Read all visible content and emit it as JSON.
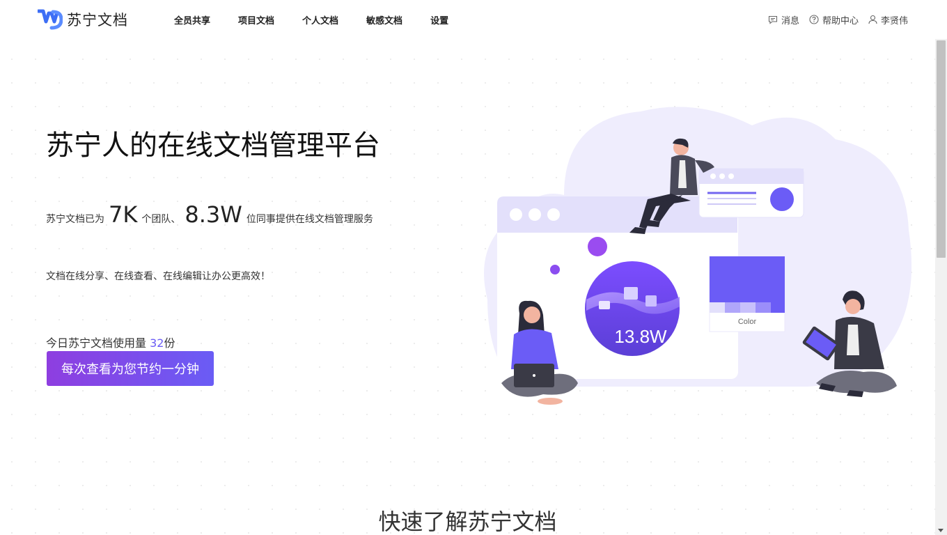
{
  "header": {
    "logo_text": "苏宁文档",
    "nav": [
      {
        "label": "全员共享"
      },
      {
        "label": "项目文档"
      },
      {
        "label": "个人文档"
      },
      {
        "label": "敏感文档"
      },
      {
        "label": "设置"
      }
    ],
    "messages_label": "消息",
    "help_label": "帮助中心",
    "user_name": "李贤伟"
  },
  "hero": {
    "title": "苏宁人的在线文档管理平台",
    "stats_prefix": "苏宁文档已为",
    "teams_value": "7K",
    "teams_suffix": "个团队、",
    "colleagues_value": "8.3W",
    "colleagues_suffix": "位同事提供在线文档管理服务",
    "tagline": "文档在线分享、在线查看、在线编辑让办公更高效！",
    "usage_label": "今日苏宁文档使用量",
    "usage_value": "32",
    "usage_unit": "份",
    "cta_label": "每次查看为您节约一分钟"
  },
  "illustration": {
    "circle_value": "13.8W",
    "color_card_label": "Color"
  },
  "section": {
    "title": "快速了解苏宁文档"
  },
  "colors": {
    "accent": "#6b5cf6",
    "cta_start": "#8e3ee0",
    "cta_end": "#6a5cf5",
    "logo_blue": "#3d6ef5"
  }
}
